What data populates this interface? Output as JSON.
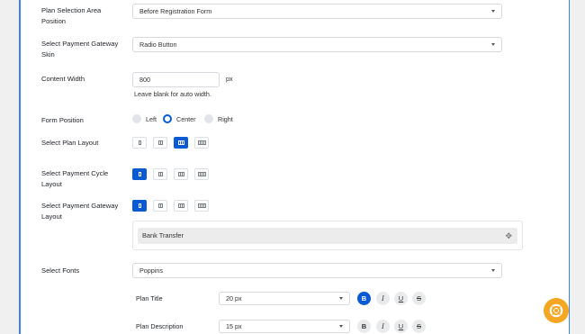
{
  "plan_selection_area": {
    "label": "Plan Selection Area Position",
    "value": "Before Registration Form"
  },
  "payment_gateway_skin": {
    "label": "Select Payment Gateway Skin",
    "value": "Radio Button"
  },
  "content_width": {
    "label": "Content Width",
    "value": "800",
    "unit": "px",
    "hint": "Leave blank for auto width."
  },
  "form_position": {
    "label": "Form Position",
    "options": [
      "Left",
      "Center",
      "Right"
    ],
    "selected": "Center"
  },
  "plan_layout": {
    "label": "Select Plan Layout",
    "selected_index": 2
  },
  "payment_cycle_layout": {
    "label": "Select Payment Cycle Layout",
    "selected_index": 0
  },
  "payment_gateway_layout": {
    "label": "Select Payment Gateway Layout",
    "selected_index": 0
  },
  "gateways": {
    "items": [
      "Bank Transfer"
    ],
    "move_icon": "move-icon"
  },
  "fonts": {
    "label": "Select Fonts",
    "value": "Poppins",
    "rows": [
      {
        "label": "Plan Title",
        "size": "20 px",
        "bold": true
      },
      {
        "label": "Plan Description",
        "size": "15 px",
        "bold": false
      }
    ],
    "format_buttons": [
      "B",
      "I",
      "U",
      "S"
    ]
  },
  "colors": {
    "accent": "#0a5ad4",
    "help_button": "#f5a623",
    "panel_border": "#3b82f6"
  }
}
